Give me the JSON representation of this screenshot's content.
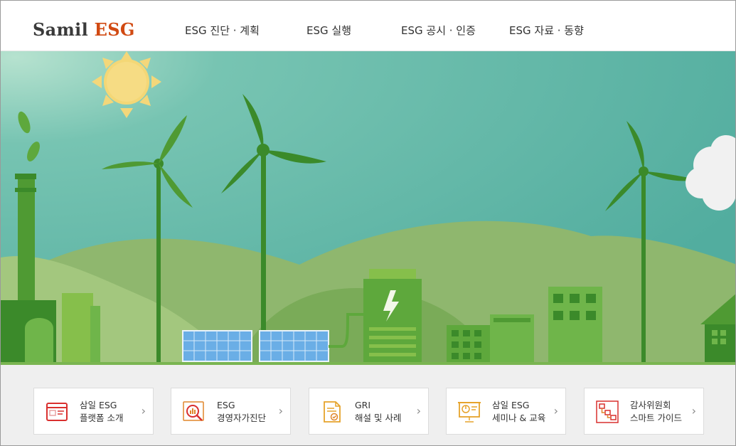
{
  "brand": {
    "part1": "Samil",
    "part2": "ESG"
  },
  "nav": [
    "ESG 진단 · 계획",
    "ESG 실행",
    "ESG 공시 · 인증",
    "ESG 자료 · 동향"
  ],
  "quick_links": [
    {
      "line1": "삼일 ESG",
      "line2": "플랫폼 소개",
      "icon": "browser-window-icon"
    },
    {
      "line1": "ESG",
      "line2": "경영자가진단",
      "icon": "magnifier-chart-icon"
    },
    {
      "line1": "GRI",
      "line2": "해설 및 사례",
      "icon": "document-check-icon"
    },
    {
      "line1": "삼일 ESG",
      "line2": "세미나 & 교육",
      "icon": "presentation-board-icon"
    },
    {
      "line1": "감사위원회",
      "line2": "스마트 가이드",
      "icon": "flowchart-icon"
    }
  ],
  "colors": {
    "brand_accent": "#d14a12",
    "sky": "#5fb6a8",
    "hill_light": "#9bbd74",
    "green_dark": "#3b8a2a",
    "green_mid": "#5ea83c",
    "green_light": "#86bf4b",
    "icon_red": "#d9302f",
    "icon_orange": "#e0862a",
    "icon_yellow": "#e6a32b"
  },
  "chevron": "›"
}
